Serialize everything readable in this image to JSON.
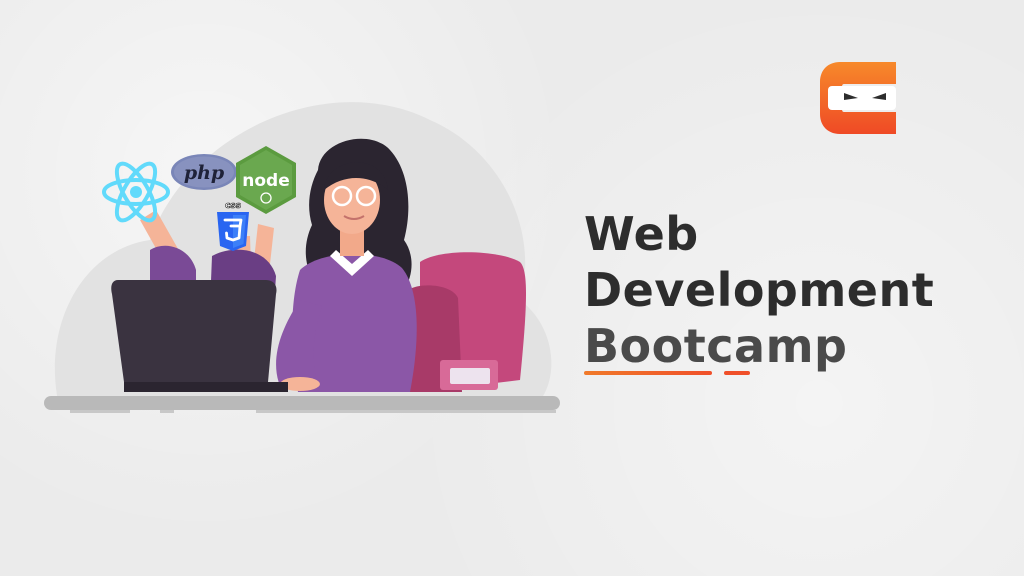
{
  "headline": {
    "line1": "Web",
    "line2": "Development",
    "line3": "Bootcamp"
  },
  "badges": {
    "php": "php",
    "node": "node",
    "css": "css"
  },
  "colors": {
    "accent_orange": "#f07a2a",
    "accent_red": "#f0502a",
    "text_dark": "#2d2d2d",
    "sweater": "#8b57a7",
    "chair": "#c4487c",
    "laptop": "#3a3340",
    "react": "#61dafb",
    "css3": "#2965f1",
    "node_green": "#6aa84f"
  },
  "icons": [
    "coding-ninjas-logo-icon",
    "react-icon",
    "php-icon",
    "node-icon",
    "css3-icon"
  ]
}
